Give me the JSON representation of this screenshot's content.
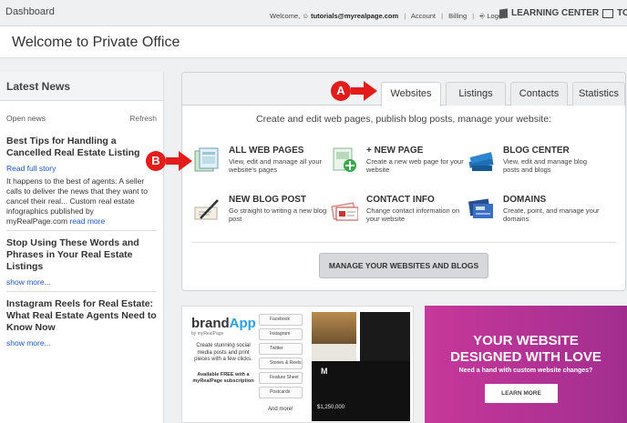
{
  "topbar": {
    "dashboard": "Dashboard",
    "welcome_prefix": "Welcome,",
    "email": "tutorials@myrealpage.com",
    "account": "Account",
    "billing": "Billing",
    "logout": "Logout",
    "learning_center": "LEARNING CENTER",
    "tour": "TOUR"
  },
  "welcome": {
    "title": "Welcome to Private Office"
  },
  "news": {
    "header": "Latest News",
    "open_news": "Open news",
    "refresh": "Refresh",
    "items": [
      {
        "title": "Best Tips for Handling a Cancelled Real Estate Listing",
        "link": "Read full story",
        "text": "It happens to the best of agents: A seller calls to deliver the news that they want to cancel their real... Custom real estate infographics published by myRealPage.com",
        "more": "read more"
      },
      {
        "title": "Stop Using These Words and Phrases in Your Real Estate Listings",
        "more": "show more..."
      },
      {
        "title": "Instagram Reels for Real Estate: What Real Estate Agents Need to Know Now",
        "more": "show more..."
      }
    ]
  },
  "tabs": [
    "Websites",
    "Listings",
    "Contacts",
    "Statistics"
  ],
  "intro": "Create and edit web pages, publish blog posts, manage your website:",
  "features": [
    {
      "title": "ALL WEB PAGES",
      "desc": "View, edit and manage all your website's pages",
      "icon": "web-pages-icon"
    },
    {
      "title": "+ NEW PAGE",
      "desc": "Create a new web page for your website",
      "icon": "new-page-icon"
    },
    {
      "title": "BLOG CENTER",
      "desc": "View, edit and manage blog posts and blogs",
      "icon": "blog-center-icon"
    },
    {
      "title": "NEW BLOG POST",
      "desc": "Go straight to writing a new blog post",
      "icon": "new-blog-post-icon"
    },
    {
      "title": "CONTACT INFO",
      "desc": "Change contact information on your website",
      "icon": "contact-info-icon"
    },
    {
      "title": "DOMAINS",
      "desc": "Create, point, and manage your domains",
      "icon": "domains-icon"
    }
  ],
  "manage_button": "MANAGE YOUR WEBSITES AND BLOGS",
  "callouts": {
    "a": "A",
    "b": "B"
  },
  "brand_banner": {
    "logo_a": "brand",
    "logo_b": "App",
    "logo_sub": "by myRealPage",
    "desc": "Create stunning social media posts and print pieces with a few clicks.",
    "avail": "Available FREE with a myRealPage subscription",
    "menu": [
      "Facebook",
      "Instagram",
      "Twitter",
      "Stories & Reels",
      "Feature Sheet",
      "Postcards"
    ],
    "more": "And more!",
    "listing_letter": "M",
    "price": "$1,250,000"
  },
  "promo_banner": {
    "line1": "YOUR WEBSITE",
    "line2": "DESIGNED WITH LOVE",
    "sub": "Need a hand with custom website changes?",
    "button": "LEARN MORE"
  },
  "colors": {
    "callout": "#e21b1b",
    "link": "#1a55c9",
    "promo": "#b8338f"
  }
}
